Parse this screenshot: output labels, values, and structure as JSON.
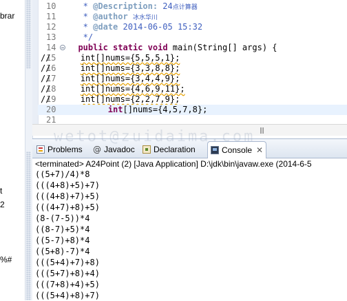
{
  "left_explorer": {
    "fragments": [
      "brar",
      "t",
      "2",
      "%#"
    ]
  },
  "editor": {
    "lines": [
      {
        "num": "10",
        "kind": "doc_desc",
        "prefix": "   * ",
        "tag": "@Description:",
        "value": " 24",
        "cjk": "点计算器"
      },
      {
        "num": "11",
        "kind": "doc_author",
        "prefix": "   * ",
        "tag": "@author",
        "value": " ",
        "cjk": "冰水华川"
      },
      {
        "num": "12",
        "kind": "doc_date",
        "prefix": "   * ",
        "tag": "@date",
        "value": " 2014-06-05 15:32"
      },
      {
        "num": "13",
        "kind": "doc_end",
        "text": "   */"
      },
      {
        "num": "14",
        "kind": "method",
        "indent": "  ",
        "kw1": "public",
        "kw2": "static",
        "kw3": "void",
        "rest": " main(String[] args) {"
      },
      {
        "num": "15",
        "kind": "commented",
        "slashes": "//",
        "pad": "      ",
        "type": "int",
        "rest": "[]nums={5,5,5,1};"
      },
      {
        "num": "16",
        "kind": "commented",
        "slashes": "//",
        "pad": "      ",
        "type": "int",
        "rest": "[]nums={3,3,8,8};"
      },
      {
        "num": "17",
        "kind": "commented",
        "slashes": "//",
        "pad": "      ",
        "type": "int",
        "rest": "[]nums={3,4,4,9};"
      },
      {
        "num": "18",
        "kind": "commented",
        "slashes": "//",
        "pad": "      ",
        "type": "int",
        "rest": "[]nums={4,6,9,11};"
      },
      {
        "num": "19",
        "kind": "commented",
        "slashes": "//",
        "pad": "      ",
        "type": "int",
        "rest": "[]nums={2,2,7,9};"
      },
      {
        "num": "20",
        "kind": "active",
        "pad": "        ",
        "type": "int",
        "rest": "[]nums={4,5,7,8};"
      },
      {
        "num": "21",
        "kind": "blank"
      }
    ],
    "scroll_grip": "|||"
  },
  "panel": {
    "tabs": [
      {
        "label": "Problems",
        "icon": "problems-icon"
      },
      {
        "label": "Javadoc",
        "icon": "at-sign-icon",
        "glyph": "@"
      },
      {
        "label": "Declaration",
        "icon": "declaration-icon"
      },
      {
        "label": "Console",
        "icon": "console-icon",
        "close": "✕",
        "active": true
      }
    ],
    "status": "<terminated> A24Point (2) [Java Application] D:\\jdk\\bin\\javaw.exe (2014-6-5",
    "output": [
      "((5+7)/4)*8",
      "(((4+8)+5)+7)",
      "(((4+8)+7)+5)",
      "(((4+7)+8)+5)",
      "(8-(7-5))*4",
      "((8-7)+5)*4",
      "((5-7)+8)*4",
      "((5+8)-7)*4",
      "(((5+4)+7)+8)",
      "(((5+7)+8)+4)",
      "(((7+8)+4)+5)",
      "(((5+4)+8)+7)"
    ],
    "watermark": "wetot@zuidaima.com"
  },
  "colors": {
    "comment": "#3f5fbf",
    "keyword": "#7f0055",
    "javadoc_tag": "#7f9fbf",
    "line_number": "#787878",
    "current_line": "#e8f2fe"
  }
}
